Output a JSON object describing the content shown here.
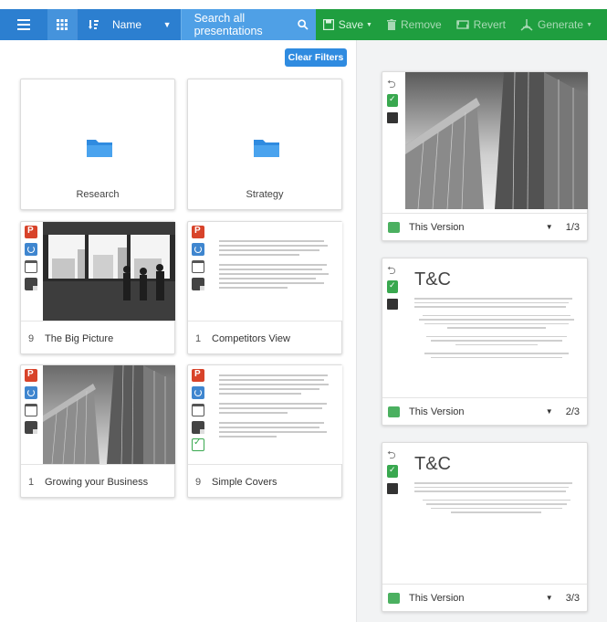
{
  "toolbar": {
    "sort_label": "Name",
    "search_label": "Search all presentations",
    "save_label": "Save",
    "remove_label": "Remove",
    "revert_label": "Revert",
    "generate_label": "Generate"
  },
  "filters": {
    "clear_label": "Clear Filters"
  },
  "folders": [
    {
      "label": "Research"
    },
    {
      "label": "Strategy"
    }
  ],
  "presentations": [
    {
      "count": "9",
      "title": "The Big Picture"
    },
    {
      "count": "1",
      "title": "Competitors View"
    },
    {
      "count": "1",
      "title": "Growing your Business"
    },
    {
      "count": "9",
      "title": "Simple Covers"
    }
  ],
  "slides": [
    {
      "version_label": "This Version",
      "page": "1/3"
    },
    {
      "title": "T&C",
      "version_label": "This Version",
      "page": "2/3"
    },
    {
      "title": "T&C",
      "version_label": "This Version",
      "page": "3/3"
    }
  ],
  "colors": {
    "toolbar_blue": "#2c7fd0",
    "search_blue": "#4fa0e6",
    "toolbar_green": "#1f9e3f",
    "folder_blue": "#2f8be0"
  }
}
